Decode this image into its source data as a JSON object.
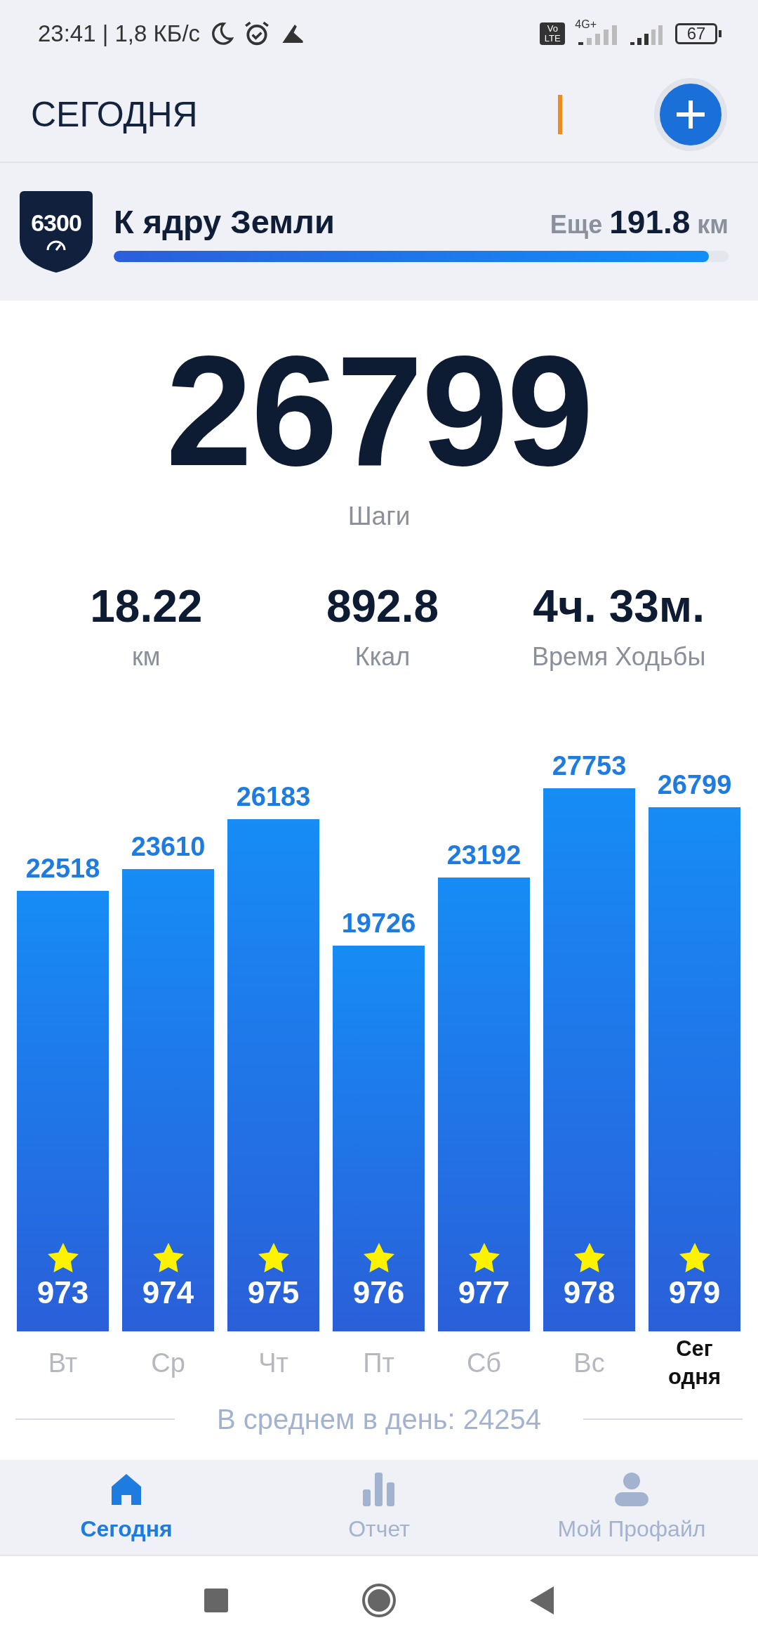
{
  "status_bar": {
    "time_speed": "23:41 | 1,8 КБ/с",
    "volte": "Vo LTE",
    "network": "4G+",
    "battery": "67"
  },
  "header": {
    "title": "СЕГОДНЯ"
  },
  "goal": {
    "badge": "6300",
    "title": "К ядру Земли",
    "remaining_label": "Еще",
    "remaining_value": "191.8",
    "remaining_unit": "км",
    "level": 0.968
  },
  "steps": {
    "value": "26799",
    "label": "Шаги"
  },
  "stats": [
    {
      "value": "18.22",
      "label": "км"
    },
    {
      "value": "892.8",
      "label": "Ккал"
    },
    {
      "value": "4ч. 33м.",
      "label": "Время Ходьбы"
    }
  ],
  "week": {
    "chart_data": {
      "type": "bar",
      "categories": [
        "Вт",
        "Ср",
        "Чт",
        "Пт",
        "Сб",
        "Вс",
        "Сег\nодня"
      ],
      "values": [
        22518,
        23610,
        26183,
        19726,
        23192,
        27753,
        26799
      ],
      "data_labels": true
    },
    "bars": [
      {
        "badge": "973",
        "today": false
      },
      {
        "badge": "974",
        "today": false
      },
      {
        "badge": "975",
        "today": false
      },
      {
        "badge": "976",
        "today": false
      },
      {
        "badge": "977",
        "today": false
      },
      {
        "badge": "978",
        "today": false
      },
      {
        "badge": "979",
        "today": true
      }
    ]
  },
  "average": "В среднем в день: 24254",
  "tabs": [
    {
      "label": "Сегодня",
      "kind": "home",
      "selected": true
    },
    {
      "label": "Отчет",
      "kind": "chart",
      "selected": false
    },
    {
      "label": "Мой Профайл",
      "kind": "profile",
      "selected": false
    }
  ]
}
